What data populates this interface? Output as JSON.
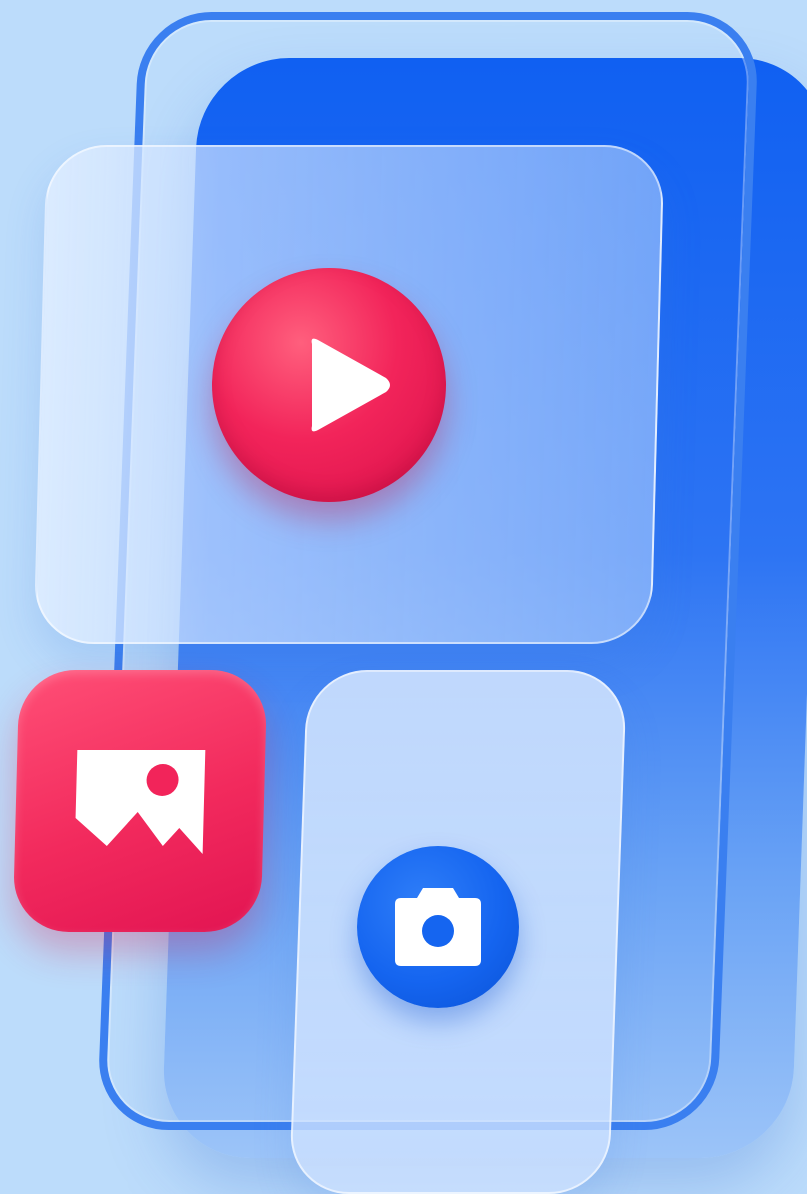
{
  "illustration": {
    "colors": {
      "background": "#bcdcfb",
      "phone": "#1060f2",
      "phone_outline": "#3a7ff0",
      "accent_red": "#f2245a",
      "accent_blue": "#1565f0",
      "icon_fill": "#ffffff"
    },
    "icons": {
      "play": "play-icon",
      "gallery": "image-icon",
      "camera": "camera-icon"
    }
  }
}
